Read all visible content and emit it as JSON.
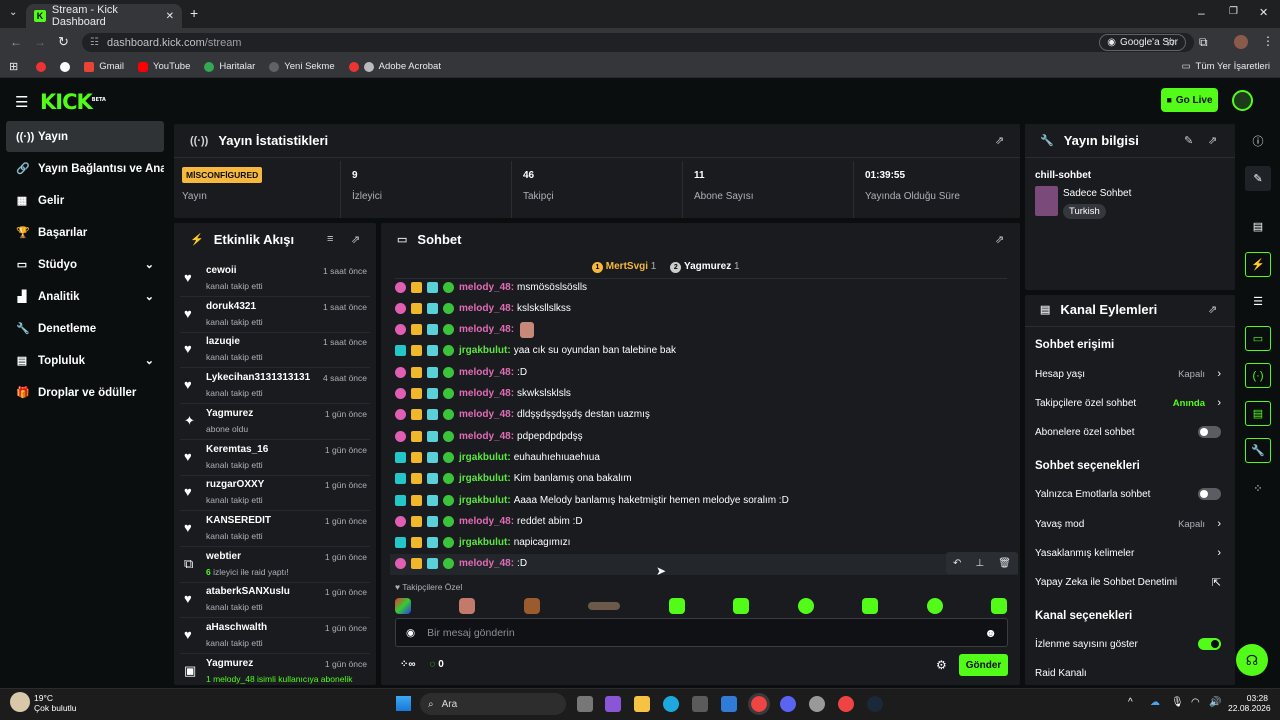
{
  "browser": {
    "tab_title": "Stream - Kick Dashboard",
    "url_domain": "dashboard.kick.com",
    "url_path": "/stream",
    "google_sor": "Google'a Sor",
    "bookmarks": [
      "Gmail",
      "YouTube",
      "Haritalar",
      "Yeni Sekme",
      "Adobe Acrobat"
    ],
    "all_bookmarks": "Tüm Yer İşaretleri"
  },
  "header": {
    "logo": "KICK",
    "logo_beta": "BETA",
    "go_live": "Go Live"
  },
  "sidebar": {
    "items": [
      {
        "label": "Yayın",
        "icon": "broadcast-icon",
        "glyph": "((·))",
        "active": true
      },
      {
        "label": "Yayın Bağlantısı ve Anahtar",
        "icon": "link-icon",
        "glyph": "🔗"
      },
      {
        "label": "Gelir",
        "icon": "revenue-icon",
        "glyph": "▦"
      },
      {
        "label": "Başarılar",
        "icon": "trophy-icon",
        "glyph": "🏆"
      },
      {
        "label": "Stüdyo",
        "icon": "studio-icon",
        "glyph": "▭",
        "chevron": true
      },
      {
        "label": "Analitik",
        "icon": "analytics-icon",
        "glyph": "▟",
        "chevron": true
      },
      {
        "label": "Denetleme",
        "icon": "wrench-icon",
        "glyph": "🔧"
      },
      {
        "label": "Topluluk",
        "icon": "community-icon",
        "glyph": "▤",
        "chevron": true
      },
      {
        "label": "Droplar ve ödüller",
        "icon": "gift-icon",
        "glyph": "🎁"
      }
    ]
  },
  "stats": {
    "title": "Yayın İstatistikleri",
    "status_badge": "MİSCONFİGURED",
    "status_label": "Yayın",
    "viewers_value": "9",
    "viewers_label": "İzleyici",
    "followers_value": "46",
    "followers_label": "Takipçi",
    "subs_value": "11",
    "subs_label": "Abone Sayısı",
    "uptime_value": "01:39:55",
    "uptime_label": "Yayında Olduğu Süre"
  },
  "activity": {
    "title": "Etkinlik Akışı",
    "items": [
      {
        "name": "cewoii",
        "sub": "kanalı takip etti",
        "time": "1 saat önce",
        "icon": "heart-icon",
        "glyph": "♥"
      },
      {
        "name": "doruk4321",
        "sub": "kanalı takip etti",
        "time": "1 saat önce",
        "icon": "heart-icon",
        "glyph": "♥"
      },
      {
        "name": "lazuqie",
        "sub": "kanalı takip etti",
        "time": "1 saat önce",
        "icon": "heart-icon",
        "glyph": "♥"
      },
      {
        "name": "Lykecihan3131313131",
        "sub": "kanalı takip etti",
        "time": "4 saat önce",
        "icon": "heart-icon",
        "glyph": "♥"
      },
      {
        "name": "Yagmurez",
        "sub": "abone oldu",
        "time": "1 gün önce",
        "icon": "sparkle-icon",
        "glyph": "✦"
      },
      {
        "name": "Keremtas_16",
        "sub": "kanalı takip etti",
        "time": "1 gün önce",
        "icon": "heart-icon",
        "glyph": "♥"
      },
      {
        "name": "ruzgarOXXY",
        "sub": "kanalı takip etti",
        "time": "1 gün önce",
        "icon": "heart-icon",
        "glyph": "♥"
      },
      {
        "name": "KANSEREDIT",
        "sub": "kanalı takip etti",
        "time": "1 gün önce",
        "icon": "heart-icon",
        "glyph": "♥"
      },
      {
        "name": "webtier",
        "sub_count": "6",
        "sub": " izleyici ile raid yaptı!",
        "time": "1 gün önce",
        "icon": "raid-icon",
        "glyph": "⧉"
      },
      {
        "name": "ataberkSANXuslu",
        "sub": "kanalı takip etti",
        "time": "1 gün önce",
        "icon": "heart-icon",
        "glyph": "♥"
      },
      {
        "name": "aHaschwalth",
        "sub": "kanalı takip etti",
        "time": "1 gün önce",
        "icon": "heart-icon",
        "glyph": "♥"
      },
      {
        "name": "Yagmurez",
        "sub": "1 melody_48 isimli kullanıcıya abonelik",
        "time": "1 gün önce",
        "icon": "gift-icon",
        "glyph": "▣"
      }
    ]
  },
  "chat": {
    "title": "Sohbet",
    "pinned_users": [
      {
        "name": "MertSvgi",
        "count": "1"
      },
      {
        "name": "Yagmurez",
        "count": "1"
      }
    ],
    "messages": [
      {
        "user": "melody_48",
        "text": "msmösöslsöslls",
        "kind": "melody"
      },
      {
        "user": "melody_48",
        "text": "kslsksllslkss",
        "kind": "melody"
      },
      {
        "user": "melody_48",
        "text": "",
        "kind": "melody",
        "emote": true
      },
      {
        "user": "jrgakbulut",
        "text": "yaa cık su oyundan ban talebine bak",
        "kind": "jrg"
      },
      {
        "user": "melody_48",
        "text": ":D",
        "kind": "melody"
      },
      {
        "user": "melody_48",
        "text": "skwkslsklsls",
        "kind": "melody"
      },
      {
        "user": "melody_48",
        "text": "dldşşdşşdşşdş destan uazmış",
        "kind": "melody"
      },
      {
        "user": "melody_48",
        "text": "pdpepdpdpdşş",
        "kind": "melody"
      },
      {
        "user": "jrgakbulut",
        "text": "euhauhıehıuaehıua",
        "kind": "jrg"
      },
      {
        "user": "jrgakbulut",
        "text": "Kim banlamış ona bakalım",
        "kind": "jrg"
      },
      {
        "user": "jrgakbulut",
        "text": "Aaaa Melody banlamış haketmiştir hemen melodye soralım :D",
        "kind": "jrg"
      },
      {
        "user": "melody_48",
        "text": "reddet abim :D",
        "kind": "melody"
      },
      {
        "user": "jrgakbulut",
        "text": "napicagımızı",
        "kind": "jrg"
      },
      {
        "user": "melody_48",
        "text": ":D",
        "kind": "melody"
      }
    ],
    "followers_only": "Takipçilere Özel",
    "input_placeholder": "Bir mesaj gönderin",
    "points": "0",
    "send": "Gönder"
  },
  "stream_info": {
    "title": "Yayın bilgisi",
    "stream_title": "chill-sohbet",
    "category": "Sadece Sohbet",
    "language": "Turkish"
  },
  "channel_actions": {
    "title": "Kanal Eylemleri",
    "section1": "Sohbet erişimi",
    "hesap_yasi": "Hesap yaşı",
    "hesap_yasi_val": "Kapalı",
    "takipci_ozel": "Takipçilere özel sohbet",
    "takipci_ozel_val": "Anında",
    "abone_ozel": "Abonelere özel sohbet",
    "section2": "Sohbet seçenekleri",
    "emote_only": "Yalnızca Emotlarla sohbet",
    "slow_mode": "Yavaş mod",
    "slow_mode_val": "Kapalı",
    "banned_words": "Yasaklanmış kelimeler",
    "ai_moderation": "Yapay Zeka ile Sohbet Denetimi",
    "section3": "Kanal seçenekleri",
    "show_views": "İzlenme sayısını göster",
    "raid": "Raid Kanalı"
  },
  "taskbar": {
    "weather_temp": "19°C",
    "weather_desc": "Çok bulutlu",
    "search": "Ara",
    "time": "03:28",
    "date": "22.08.2026"
  },
  "colors": {
    "accent": "#53fc18",
    "panel": "#191b1f",
    "bg": "#0b0e0f",
    "warning": "#f6b83d"
  }
}
